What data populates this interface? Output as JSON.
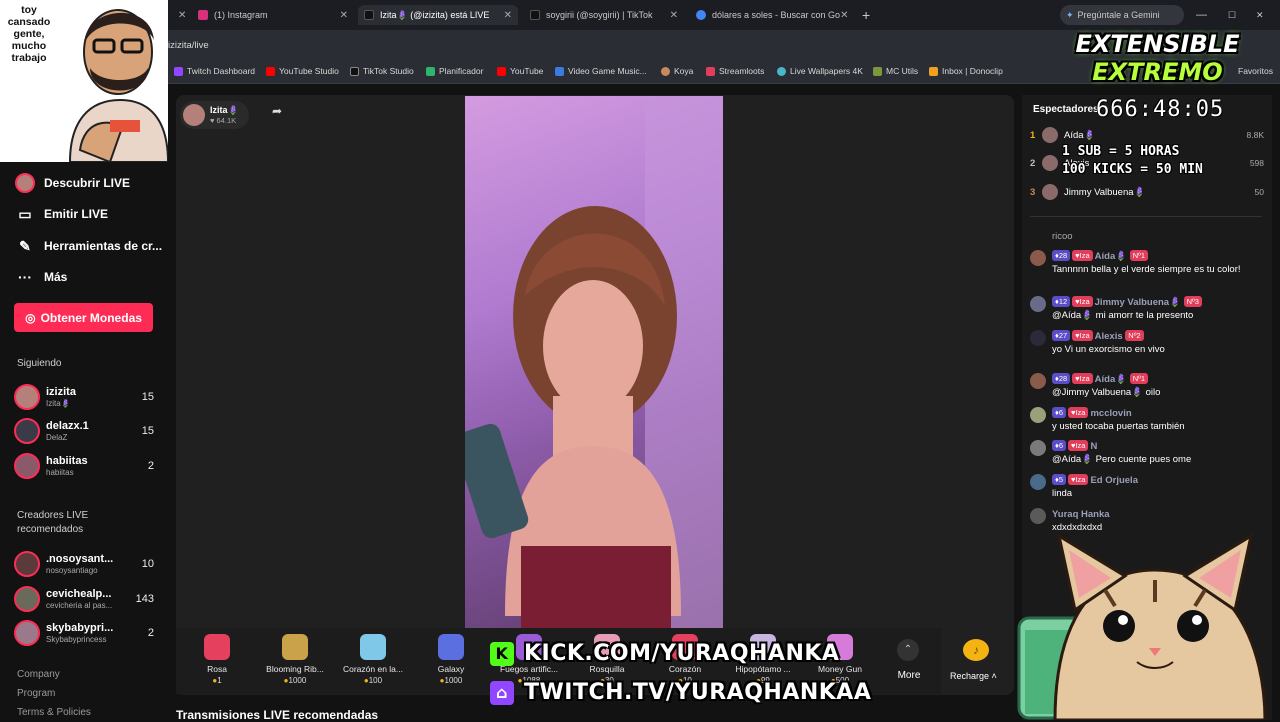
{
  "webcam_caption": "toy cansado gente, mucho trabajo",
  "tabs": [
    {
      "label": "(1) Instagram"
    },
    {
      "label": "Izita🪻 (@izizita) está LIVE"
    },
    {
      "label": "soygirii (@soygirii) | TikTok"
    },
    {
      "label": "dólares a soles - Buscar con Go"
    }
  ],
  "gemini_label": "Pregúntale a Gemini",
  "address": "izizita/live",
  "bookmarks": [
    "Twitch Dashboard",
    "YouTube Studio",
    "TikTok Studio",
    "Planificador",
    "YouTube",
    "Video Game Music...",
    "Koya",
    "Streamloots",
    "Live Wallpapers 4K",
    "MC Utils",
    "Inbox | Donoclip",
    "Favoritos"
  ],
  "sidebar": {
    "nav": [
      {
        "label": "Descubrir LIVE",
        "icon": "avatar-icon"
      },
      {
        "label": "Emitir LIVE",
        "icon": "video-camera-icon"
      },
      {
        "label": "Herramientas de cr...",
        "icon": "edit-icon"
      },
      {
        "label": "Más",
        "icon": "more-icon"
      }
    ],
    "coins_button": "Obtener Monedas",
    "following_title": "Siguiendo",
    "following": [
      {
        "name": "izizita",
        "sub": "Izita🪻",
        "count": "15"
      },
      {
        "name": "delazx.1",
        "sub": "DelaZ",
        "count": "15"
      },
      {
        "name": "habiitas",
        "sub": "habiitas",
        "count": "2"
      }
    ],
    "recommended_title": "Creadores LIVE recomendados",
    "recommended": [
      {
        "name": ".nosoysant...",
        "sub": "nosoysantiago",
        "count": "10"
      },
      {
        "name": "cevichealp...",
        "sub": "cevicheria al pas...",
        "count": "143"
      },
      {
        "name": "skybabypri...",
        "sub": "Skybabyprincess",
        "count": "2"
      }
    ],
    "footer": [
      "Company",
      "Program",
      "Terms & Policies"
    ]
  },
  "streamer": {
    "name": "Izita🪻",
    "likes": "64.1K"
  },
  "gifts": [
    {
      "name": "Rosa",
      "price": "1",
      "color": "#e5405e"
    },
    {
      "name": "Blooming Rib...",
      "price": "1000",
      "color": "#c9a24a"
    },
    {
      "name": "Corazón en la...",
      "price": "100",
      "color": "#7fc8e8"
    },
    {
      "name": "Galaxy",
      "price": "1000",
      "color": "#5b6fe0"
    },
    {
      "name": "Fuegos artific...",
      "price": "1088",
      "color": "#9b5bd6"
    },
    {
      "name": "Rosquilla",
      "price": "30",
      "color": "#e89bb8"
    },
    {
      "name": "Corazón",
      "price": "10",
      "color": "#e5405e"
    },
    {
      "name": "Hipopótamo ...",
      "price": "99",
      "color": "#c7b7e0"
    },
    {
      "name": "Money Gun",
      "price": "500",
      "color": "#d67bd9"
    }
  ],
  "more_label": "More",
  "recharge_label": "Recharge",
  "recommended_live_title": "Transmisiones LIVE recomendadas",
  "viewers": {
    "title": "Espectadores",
    "top": [
      {
        "rank": "1",
        "name": "Aída🪻",
        "score": "8.8K"
      },
      {
        "rank": "2",
        "name": "Alexis",
        "score": "598"
      },
      {
        "rank": "3",
        "name": "Jimmy Valbuena🪻",
        "score": "50"
      }
    ]
  },
  "chat": [
    {
      "user": "",
      "text": "ricoo"
    },
    {
      "user": "Aída🪻",
      "level": "28",
      "fan": "Iza",
      "rank": "Nº1",
      "text": "Tannnnn bella y el verde siempre es tu color!"
    },
    {
      "user": "Jimmy Valbuena🪻",
      "level": "12",
      "fan": "Iza",
      "rank": "Nº3",
      "text": "@Aída🪻 mi amorr te la presento"
    },
    {
      "user": "Alexis",
      "level": "27",
      "fan": "Iza",
      "rank": "Nº2",
      "text": "yo Vi un exorcismo en vivo"
    },
    {
      "user": "Aída🪻",
      "level": "28",
      "fan": "Iza",
      "rank": "Nº1",
      "text": "@Jimmy Valbuena🪻 oilo"
    },
    {
      "user": "mcclovin",
      "level": "6",
      "fan": "Iza",
      "rank": "",
      "text": "y usted tocaba puertas también"
    },
    {
      "user": "N",
      "level": "6",
      "fan": "Iza",
      "rank": "",
      "text": "@Aída🪻 Pero cuente pues ome"
    },
    {
      "user": "Ed Orjuela",
      "level": "5",
      "fan": "Iza",
      "rank": "",
      "text": "linda"
    },
    {
      "user": "Yuraq Hanka",
      "level": "",
      "fan": "",
      "rank": "",
      "text": "xdxdxdxdxd"
    }
  ],
  "overlay": {
    "title_line1": "EXTENSIBLE",
    "title_line2": "EXTREMO",
    "timer": "666:48:05",
    "rule1": "1 SUB = 5 HORAS",
    "rule2": "100 KICKS = 50 MIN",
    "kick": "KICK.COM/YURAQHANKA",
    "twitch": "TWITCH.TV/YURAQHANKAA"
  }
}
